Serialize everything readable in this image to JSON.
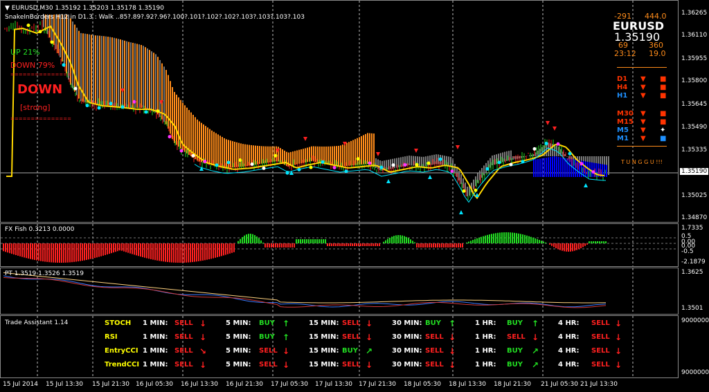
{
  "main": {
    "header_line1": "EURUSD,M30  1.35192 1.35203 1.35178 1.35190",
    "header_line2": "SnakeInBorders H12 in D1.3 :  Walk ..85?.89?.92?.96?.100?.101?.102?.102?.103?.103?.103?.103",
    "up_text": "UP",
    "up_pct": "21%",
    "down_text": "DOWN",
    "down_pct": "79%",
    "big_signal": "DOWN",
    "strength": "[strong]",
    "dashes": "===============",
    "price_ticks": [
      "1.36265",
      "1.36110",
      "1.35955",
      "1.35800",
      "1.35645",
      "1.35490",
      "1.35335",
      "1.35190",
      "1.35025",
      "1.34870"
    ],
    "current_price": "1.35190"
  },
  "info_panel": {
    "left_top": "-291",
    "right_top": "444.0",
    "symbol": "EURUSD",
    "price": "1.35190",
    "left_mid": "69",
    "right_mid": "360",
    "time_left": "23:12",
    "time_right": "19.0",
    "timeframes": [
      {
        "tf": "D1",
        "color": "#ff3300",
        "arrow": "▼",
        "box": "■",
        "box_color": "#ff3300"
      },
      {
        "tf": "H4",
        "color": "#ff3300",
        "arrow": "▼",
        "box": "■",
        "box_color": "#ff3300"
      },
      {
        "tf": "H1",
        "color": "#1e90ff",
        "arrow": "▼",
        "box": "■",
        "box_color": "#ff3300"
      },
      {
        "tf": "M30",
        "color": "#ff3300",
        "arrow": "▼",
        "box": "■",
        "box_color": "#ff3300"
      },
      {
        "tf": "M15",
        "color": "#ff3300",
        "arrow": "▼",
        "box": "■",
        "box_color": "#ff3300"
      },
      {
        "tf": "M5",
        "color": "#1e90ff",
        "arrow": "▼",
        "box": "✦",
        "box_color": "#ffffff"
      },
      {
        "tf": "M1",
        "color": "#1e90ff",
        "arrow": "▼",
        "box": "■",
        "box_color": "#1e90ff"
      }
    ],
    "wait_text": "T U N G G U !!!"
  },
  "fish": {
    "title": "FX Fish 0.3213 0.0000",
    "ticks": [
      "1.7335",
      "0.5",
      "0.00",
      "0.00",
      "-0.5",
      "-2.1879"
    ]
  },
  "pt": {
    "title": "PT 1.3519 1.3526 1.3519",
    "ticks": [
      "1.3625",
      "1.3501"
    ]
  },
  "assistant": {
    "title": "Trade Assistant 1.14",
    "ticks": [
      "9000000",
      "9000000"
    ],
    "rows": [
      {
        "name": "STOCH",
        "cells": [
          {
            "tf": "1 MIN:",
            "sig": "SELL",
            "arr": "↓",
            "type": "sell"
          },
          {
            "tf": "5 MIN:",
            "sig": "BUY",
            "arr": "↑",
            "type": "buy"
          },
          {
            "tf": "15 MIN:",
            "sig": "SELL",
            "arr": "↓",
            "type": "sell"
          },
          {
            "tf": "30 MIN:",
            "sig": "BUY",
            "arr": "↑",
            "type": "buy"
          },
          {
            "tf": "1 HR:",
            "sig": "BUY",
            "arr": "↑",
            "type": "buy"
          },
          {
            "tf": "4 HR:",
            "sig": "SELL",
            "arr": "↓",
            "type": "sell"
          }
        ]
      },
      {
        "name": "RSI",
        "cells": [
          {
            "tf": "1 MIN:",
            "sig": "SELL",
            "arr": "↓",
            "type": "sell"
          },
          {
            "tf": "5 MIN:",
            "sig": "BUY",
            "arr": "↑",
            "type": "buy"
          },
          {
            "tf": "15 MIN:",
            "sig": "SELL",
            "arr": "↓",
            "type": "sell"
          },
          {
            "tf": "30 MIN:",
            "sig": "SELL",
            "arr": "↓",
            "type": "sell"
          },
          {
            "tf": "1 HR:",
            "sig": "SELL",
            "arr": "↓",
            "type": "sell"
          },
          {
            "tf": "4 HR:",
            "sig": "SELL",
            "arr": "↓",
            "type": "sell"
          }
        ]
      },
      {
        "name": "EntryCCI",
        "cells": [
          {
            "tf": "1 MIN:",
            "sig": "SELL",
            "arr": "↘",
            "type": "sell"
          },
          {
            "tf": "5 MIN:",
            "sig": "SELL",
            "arr": "↓",
            "type": "sell"
          },
          {
            "tf": "15 MIN:",
            "sig": "BUY",
            "arr": "↗",
            "type": "buy"
          },
          {
            "tf": "30 MIN:",
            "sig": "SELL",
            "arr": "↓",
            "type": "sell"
          },
          {
            "tf": "1 HR:",
            "sig": "BUY",
            "arr": "↗",
            "type": "buy"
          },
          {
            "tf": "4 HR:",
            "sig": "SELL",
            "arr": "↓",
            "type": "sell"
          }
        ]
      },
      {
        "name": "TrendCCI",
        "cells": [
          {
            "tf": "1 MIN:",
            "sig": "SELL",
            "arr": "↓",
            "type": "sell"
          },
          {
            "tf": "5 MIN:",
            "sig": "SELL",
            "arr": "↓",
            "type": "sell"
          },
          {
            "tf": "15 MIN:",
            "sig": "SELL",
            "arr": "↓",
            "type": "sell"
          },
          {
            "tf": "30 MIN:",
            "sig": "SELL",
            "arr": "↓",
            "type": "sell"
          },
          {
            "tf": "1 HR:",
            "sig": "BUY",
            "arr": "↗",
            "type": "buy"
          },
          {
            "tf": "4 HR:",
            "sig": "SELL",
            "arr": "↓",
            "type": "sell"
          }
        ]
      }
    ]
  },
  "time_axis": [
    "15 Jul 2014",
    "15 Jul 13:30",
    "15 Jul 21:30",
    "16 Jul 05:30",
    "16 Jul 13:30",
    "16 Jul 21:30",
    "17 Jul 05:30",
    "17 Jul 13:30",
    "17 Jul 21:30",
    "18 Jul 05:30",
    "18 Jul 13:30",
    "18 Jul 21:30",
    "21 Jul 05:30",
    "21 Jul 13:30"
  ],
  "colors": {
    "bull": "#22dd22",
    "bear": "#ff2020",
    "cloud_up": "#ff8c1a",
    "cloud_dn": "#7a7a7a",
    "ma": "#ffd700",
    "accent": "#ff3300"
  }
}
